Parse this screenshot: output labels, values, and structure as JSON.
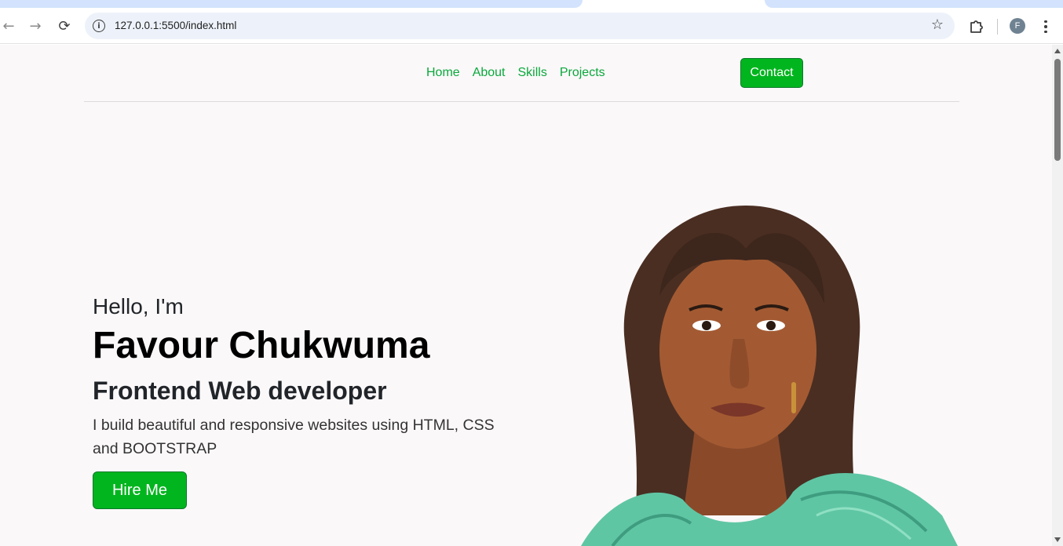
{
  "browser": {
    "url": "127.0.0.1:5500/index.html",
    "profile_initial": "F",
    "icons": {
      "back": "arrow-left-icon",
      "forward": "arrow-right-icon",
      "reload": "reload-icon",
      "site_info": "info-icon",
      "bookmark": "star-icon",
      "extensions": "puzzle-icon",
      "menu": "three-dots-vertical-icon"
    }
  },
  "nav": {
    "links": [
      "Home",
      "About",
      "Skills",
      "Projects"
    ],
    "contact_label": "Contact"
  },
  "hero": {
    "greeting": "Hello, I'm",
    "name": "Favour Chukwuma",
    "role": "Frontend Web developer",
    "description": "I build beautiful and responsive websites using HTML, CSS and BOOTSTRAP",
    "cta_label": "Hire Me"
  },
  "colors": {
    "accent_green": "#00b51e",
    "link_green": "#0aa83c",
    "page_background": "#fbf8f9"
  }
}
